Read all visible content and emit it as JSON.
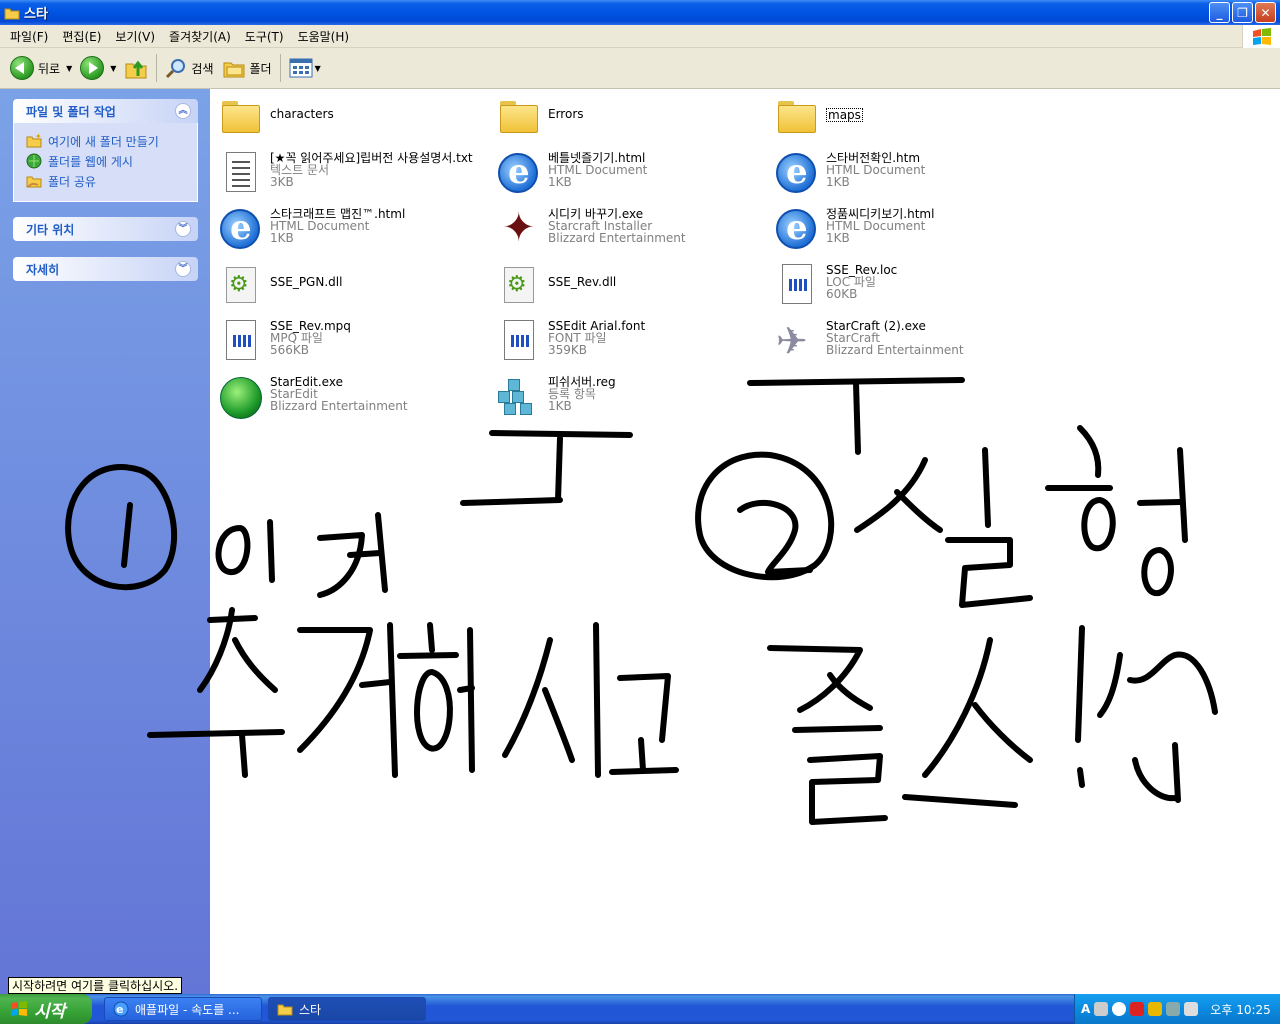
{
  "window": {
    "title": "스타",
    "buttons": {
      "minimize": "_",
      "maximize": "❐",
      "close": "✕"
    }
  },
  "menu": [
    {
      "label": "파일(F)"
    },
    {
      "label": "편집(E)"
    },
    {
      "label": "보기(V)"
    },
    {
      "label": "즐겨찾기(A)"
    },
    {
      "label": "도구(T)"
    },
    {
      "label": "도움말(H)"
    }
  ],
  "toolbar": {
    "back_label": "뒤로",
    "search_label": "검색",
    "folders_label": "폴더"
  },
  "sidebar": {
    "file_tasks": {
      "title": "파일 및 폴더 작업",
      "items": [
        {
          "label": "여기에 새 폴더 만들기",
          "icon": "new-folder-icon"
        },
        {
          "label": "폴더를 웹에 게시",
          "icon": "web-publish-icon"
        },
        {
          "label": "폴더 공유",
          "icon": "share-folder-icon"
        }
      ]
    },
    "other_places": {
      "title": "기타 위치"
    },
    "details": {
      "title": "자세히"
    }
  },
  "files": [
    {
      "name": "characters",
      "icon": "folder-icon"
    },
    {
      "name": "Errors",
      "icon": "folder-icon"
    },
    {
      "name": "maps",
      "icon": "folder-icon"
    },
    {
      "name": "[★꼭 읽어주세요]립버전 사용설명서.txt",
      "type": "텍스트 문서",
      "size": "3KB",
      "icon": "text-document-icon"
    },
    {
      "name": "베틀넷즐기기.html",
      "type": "HTML Document",
      "size": "1KB",
      "icon": "internet-explorer-icon"
    },
    {
      "name": "스타버전확인.htm",
      "type": "HTML Document",
      "size": "1KB",
      "icon": "internet-explorer-icon"
    },
    {
      "name": "스타크래프트 맵진™.html",
      "type": "HTML Document",
      "size": "1KB",
      "icon": "internet-explorer-icon"
    },
    {
      "name": "시디키 바꾸기.exe",
      "type": "Starcraft Installer",
      "size": "Blizzard Entertainment",
      "icon": "starcraft-installer-icon"
    },
    {
      "name": "정품씨디키보기.html",
      "type": "HTML Document",
      "size": "1KB",
      "icon": "internet-explorer-icon"
    },
    {
      "name": "SSE_PGN.dll",
      "icon": "dll-gear-icon"
    },
    {
      "name": "SSE_Rev.dll",
      "icon": "dll-gear-icon"
    },
    {
      "name": "SSE_Rev.loc",
      "type": "LOC 파일",
      "size": "60KB",
      "icon": "generic-file-icon"
    },
    {
      "name": "SSE_Rev.mpq",
      "type": "MPQ 파일",
      "size": "566KB",
      "icon": "generic-file-icon"
    },
    {
      "name": "SSEdit Arial.font",
      "type": "FONT 파일",
      "size": "359KB",
      "icon": "generic-file-icon"
    },
    {
      "name": "StarCraft (2).exe",
      "type": "StarCraft",
      "size": "Blizzard Entertainment",
      "icon": "starcraft-ship-icon"
    },
    {
      "name": "StarEdit.exe",
      "type": "StarEdit",
      "size": "Blizzard Entertainment",
      "icon": "staredit-globe-icon"
    },
    {
      "name": "피쉬서버.reg",
      "type": "등록 항목",
      "size": "1KB",
      "icon": "registry-icon"
    }
  ],
  "tooltip": "시작하려면 여기를 클릭하십시오.",
  "taskbar": {
    "start_label": "시작",
    "tasks": [
      {
        "label": "애플파일 - 속도를 ..."
      },
      {
        "label": "스타"
      }
    ],
    "language": "A",
    "clock": "오후 10:25"
  },
  "colors": {
    "titlebar": "#0054e3",
    "sidebar": "#6f8fe0",
    "link": "#215dc6",
    "taskbar": "#2157d7",
    "start": "#36a336"
  }
}
